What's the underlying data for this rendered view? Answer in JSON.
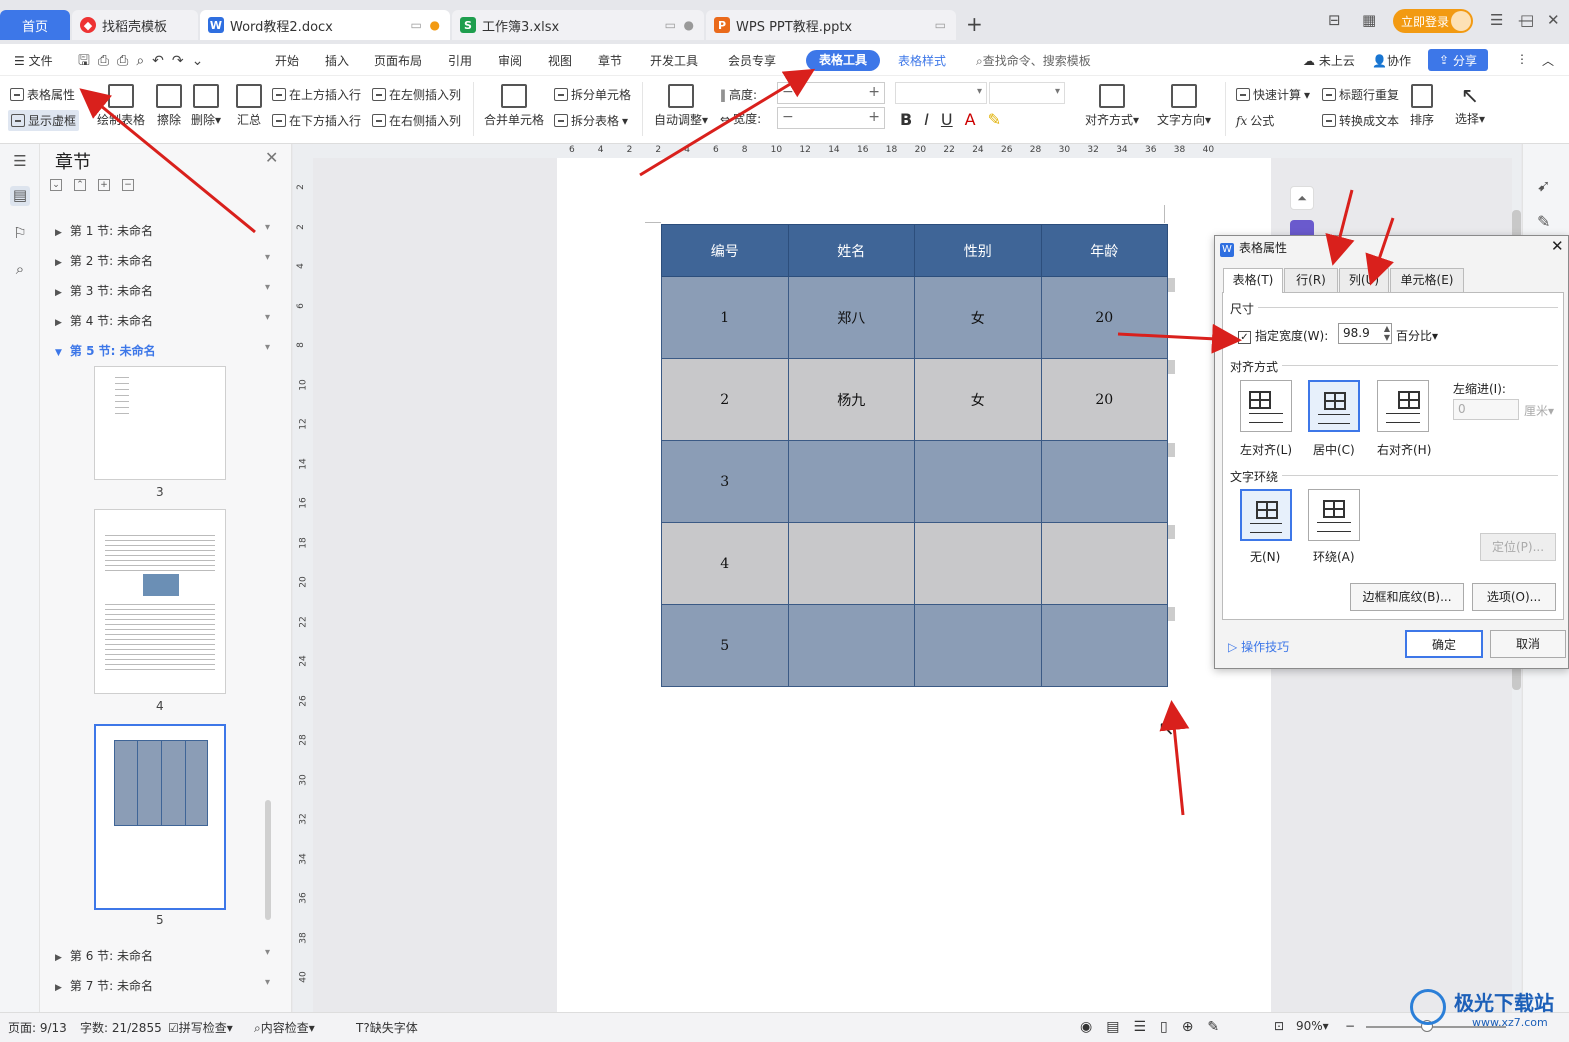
{
  "tabs": {
    "home": "首页",
    "docer": "找稻壳模板",
    "word": "Word教程2.docx",
    "xlsx": "工作簿3.xlsx",
    "ppt": "WPS PPT教程.pptx",
    "add": "+",
    "login": "立即登录"
  },
  "menu": {
    "file": "文件",
    "items": [
      "开始",
      "插入",
      "页面布局",
      "引用",
      "审阅",
      "视图",
      "章节",
      "开发工具",
      "会员专享"
    ],
    "table_tools": "表格工具",
    "table_style": "表格样式",
    "search": "查找命令、搜索模板",
    "cloud": "未上云",
    "collab": "协作",
    "share": "分享"
  },
  "ribbon": {
    "table_props": "表格属性",
    "show_grid": "显示虚框",
    "draw_table": "绘制表格",
    "erase": "擦除",
    "delete": "删除",
    "summary": "汇总",
    "insert_above": "在上方插入行",
    "insert_below": "在下方插入行",
    "insert_left": "在左侧插入列",
    "insert_right": "在右侧插入列",
    "merge": "合并单元格",
    "split_cell": "拆分单元格",
    "split_table": "拆分表格",
    "auto_adjust": "自动调整",
    "height": "高度:",
    "width": "宽度:",
    "align": "对齐方式",
    "text_dir": "文字方向",
    "quick_calc": "快速计算",
    "formula": "公式",
    "title_repeat": "标题行重复",
    "to_text": "转换成文本",
    "sort": "排序",
    "select": "选择"
  },
  "nav": {
    "title": "章节",
    "sections": [
      "第 1 节: 未命名",
      "第 2 节: 未命名",
      "第 3 节: 未命名",
      "第 4 节: 未命名",
      "第 5 节: 未命名",
      "第 6 节: 未命名",
      "第 7 节: 未命名"
    ],
    "active_index": 4,
    "pages": [
      "3",
      "4",
      "5"
    ]
  },
  "ruler": {
    "h_ticks": [
      "6",
      "4",
      "2",
      "2",
      "4",
      "6",
      "8",
      "10",
      "12",
      "14",
      "16",
      "18",
      "20",
      "22",
      "24",
      "26",
      "28",
      "30",
      "32",
      "34",
      "36",
      "38",
      "40"
    ],
    "v_ticks": [
      "2",
      "2",
      "4",
      "6",
      "8",
      "10",
      "12",
      "14",
      "16",
      "18",
      "20",
      "22",
      "24",
      "26",
      "28",
      "30",
      "32",
      "34",
      "36",
      "38",
      "40"
    ]
  },
  "doc_table": {
    "headers": [
      "编号",
      "姓名",
      "性别",
      "年龄"
    ],
    "rows": [
      [
        "1",
        "郑八",
        "女",
        "20"
      ],
      [
        "2",
        "杨九",
        "女",
        "20"
      ],
      [
        "3",
        "",
        "",
        ""
      ],
      [
        "4",
        "",
        "",
        ""
      ],
      [
        "5",
        "",
        "",
        ""
      ]
    ]
  },
  "dialog": {
    "title": "表格属性",
    "tabs": [
      "表格(T)",
      "行(R)",
      "列(U)",
      "单元格(E)"
    ],
    "size_group": "尺寸",
    "specify_width": "指定宽度(W):",
    "width_value": "98.9",
    "unit": "百分比",
    "align_group": "对齐方式",
    "align_left": "左对齐(L)",
    "align_center": "居中(C)",
    "align_right": "右对齐(H)",
    "left_indent": "左缩进(I):",
    "indent_value": "0",
    "indent_unit": "厘米",
    "wrap_group": "文字环绕",
    "wrap_none": "无(N)",
    "wrap_around": "环绕(A)",
    "position": "定位(P)...",
    "borders": "边框和底纹(B)...",
    "options": "选项(O)...",
    "tips": "操作技巧",
    "ok": "确定",
    "cancel": "取消"
  },
  "status": {
    "page": "页面: 9/13",
    "words": "字数: 21/2855",
    "spell": "拼写检查",
    "content": "内容检查",
    "missing_font": "缺失字体",
    "zoom": "90%"
  },
  "watermark": "极光下载站",
  "watermark_url": "www.xz7.com",
  "colors": {
    "accent": "#3d77e8",
    "table_header": "#3f6597",
    "table_odd": "#8b9db6",
    "table_even": "#c8c8ca",
    "arrow": "#d9201c"
  }
}
